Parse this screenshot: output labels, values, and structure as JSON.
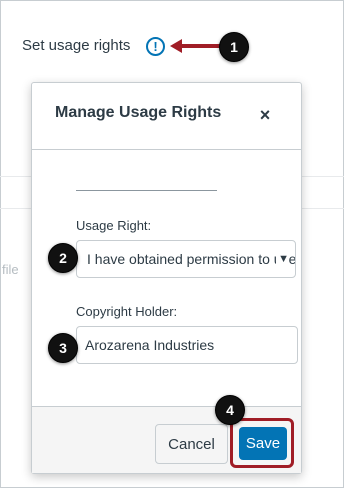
{
  "background": {
    "row_label": "Set usage rights",
    "faded_text": "file"
  },
  "callouts": [
    {
      "number": "1"
    },
    {
      "number": "2"
    },
    {
      "number": "3"
    },
    {
      "number": "4"
    }
  ],
  "modal": {
    "title": "Manage Usage Rights",
    "close_glyph": "×",
    "usage_right": {
      "label": "Usage Right:",
      "selected": "I have obtained permission to use this file."
    },
    "copyright_holder": {
      "label": "Copyright Holder:",
      "value": "Arozarena Industries"
    },
    "footer": {
      "cancel_label": "Cancel",
      "save_label": "Save"
    }
  },
  "colors": {
    "brand_blue": "#0374b5",
    "highlight_red": "#a01d26",
    "callout_black": "#111111"
  },
  "icons": {
    "warning": "warning-icon",
    "close": "close-icon",
    "chevron": "chevron-down-icon",
    "arrow": "arrow-left-icon"
  }
}
